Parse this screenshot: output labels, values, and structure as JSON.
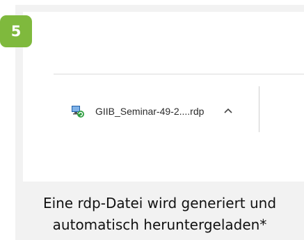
{
  "step": {
    "number": "5",
    "color": "#7fb93d"
  },
  "download_bar": {
    "file_name": "GIIB_Seminar-49-2....rdp",
    "file_icon": "remote-desktop-file-icon",
    "expand_icon": "chevron-up-icon"
  },
  "caption": {
    "line1": "Eine rdp-Datei wird generiert und",
    "line2": "automatisch heruntergeladen*"
  }
}
